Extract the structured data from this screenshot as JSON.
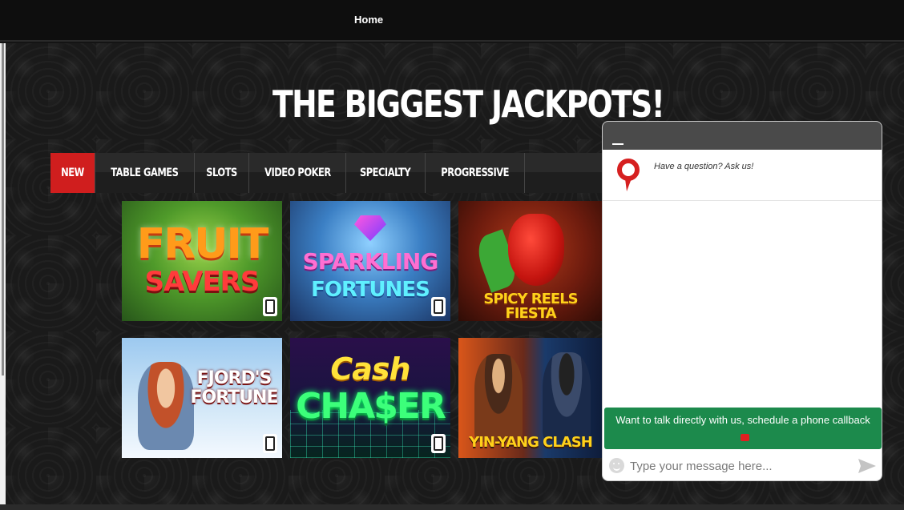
{
  "nav": {
    "home_label": "Home"
  },
  "headline": "THE BIGGEST JACKPOTS!",
  "tabs": [
    {
      "label": "NEW",
      "active": true
    },
    {
      "label": "TABLE GAMES",
      "active": false
    },
    {
      "label": "SLOTS",
      "active": false
    },
    {
      "label": "VIDEO POKER",
      "active": false
    },
    {
      "label": "SPECIALTY",
      "active": false
    },
    {
      "label": "PROGRESSIVE",
      "active": false
    }
  ],
  "games": [
    {
      "title_line1": "FRUIT",
      "title_line2": "SAVERS",
      "mobile_icon": "mobile-phone-icon"
    },
    {
      "title_line1": "SPARKLING",
      "title_line2": "FORTUNES",
      "mobile_icon": "mobile-phone-icon"
    },
    {
      "title_line1": "SPICY REELS FIESTA",
      "mobile_icon": "mobile-phone-icon"
    },
    {
      "title_line1": "FJORD'S",
      "title_line2": "FORTUNE",
      "mobile_icon": "mobile-phone-icon"
    },
    {
      "title_line1": "Cash",
      "title_line2": "CHA$ER",
      "mobile_icon": "mobile-phone-icon"
    },
    {
      "title_line1": "YIN-YANG CLASH",
      "mobile_icon": "mobile-phone-icon"
    }
  ],
  "chat": {
    "question": "Have a question? Ask us!",
    "callback_label": "Want to talk directly with us, schedule a phone callback",
    "input_placeholder": "Type your message here...",
    "icons": [
      "minimize-icon",
      "brand-logo-icon",
      "phone-icon",
      "emoji-icon",
      "send-icon"
    ]
  },
  "colors": {
    "active_tab": "#d01e1e",
    "callback_button": "#1c8a4c",
    "chat_header": "#4a4a4a"
  }
}
